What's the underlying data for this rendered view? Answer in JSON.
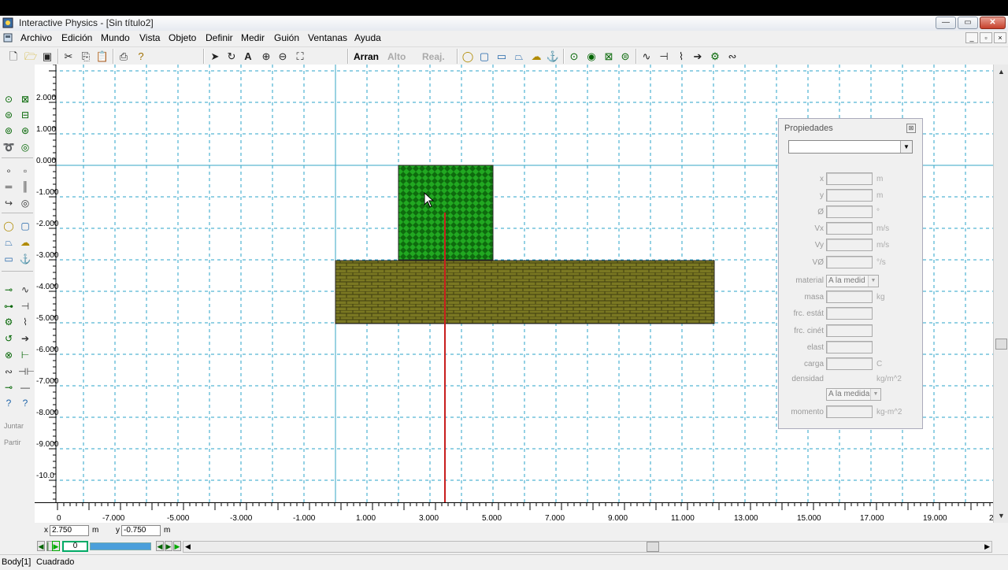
{
  "window": {
    "title": "Interactive Physics - [Sin título2]",
    "min_label": "—",
    "max_label": "▭",
    "close_label": "✕"
  },
  "menu": [
    "Archivo",
    "Edición",
    "Mundo",
    "Vista",
    "Objeto",
    "Definir",
    "Medir",
    "Guión",
    "Ventanas",
    "Ayuda"
  ],
  "toolbar": {
    "run_label": "Arran",
    "stop_label": "Alto",
    "reset_label": "Reaj."
  },
  "left_tools": {
    "join_label": "Juntar",
    "split_label": "Partir"
  },
  "colors": {
    "grid": "#29a3c8",
    "axis": "#34a6c6",
    "green_block": "#1aa01a",
    "brick_block": "#6d6b1e",
    "red_line": "#c81e1e"
  },
  "y_ruler": [
    "2.000",
    "1.000",
    "0.000",
    "-1.000",
    "-2.000",
    "-3.000",
    "-4.000",
    "-5.000",
    "-6.000",
    "-7.000",
    "-8.000",
    "-9.000",
    "-10.0"
  ],
  "x_ruler": [
    "0",
    "-7.000",
    "-5.000",
    "-3.000",
    "-1.000",
    "1.000",
    "3.000",
    "5.000",
    "7.000",
    "9.000",
    "11.000",
    "13.000",
    "15.000",
    "17.000",
    "19.000",
    "2"
  ],
  "coords": {
    "x_label": "x",
    "x_value": "2.750",
    "x_unit": "m",
    "y_label": "y",
    "y_value": "-0.750",
    "y_unit": "m"
  },
  "player": {
    "frame": "0"
  },
  "status": {
    "object": "Body[1]",
    "shape": "Cuadrado"
  },
  "properties": {
    "title": "Propiedades",
    "rows": [
      {
        "label": "x",
        "unit": "m"
      },
      {
        "label": "y",
        "unit": "m"
      },
      {
        "label": "Ø",
        "unit": "°"
      },
      {
        "label": "Vx",
        "unit": "m/s"
      },
      {
        "label": "Vy",
        "unit": "m/s"
      },
      {
        "label": "VØ",
        "unit": "°/s"
      }
    ],
    "material_label": "material",
    "material_value": "A la medid",
    "rows2": [
      {
        "label": "masa",
        "unit": "kg"
      },
      {
        "label": "frc. estát",
        "unit": ""
      },
      {
        "label": "frc. cinét",
        "unit": ""
      },
      {
        "label": "elast",
        "unit": ""
      },
      {
        "label": "carga",
        "unit": "C"
      }
    ],
    "density_label": "densidad",
    "density_unit": "kg/m^2",
    "density_value": "A la medida",
    "moment_label": "momento",
    "moment_unit": "kg-m^2"
  }
}
